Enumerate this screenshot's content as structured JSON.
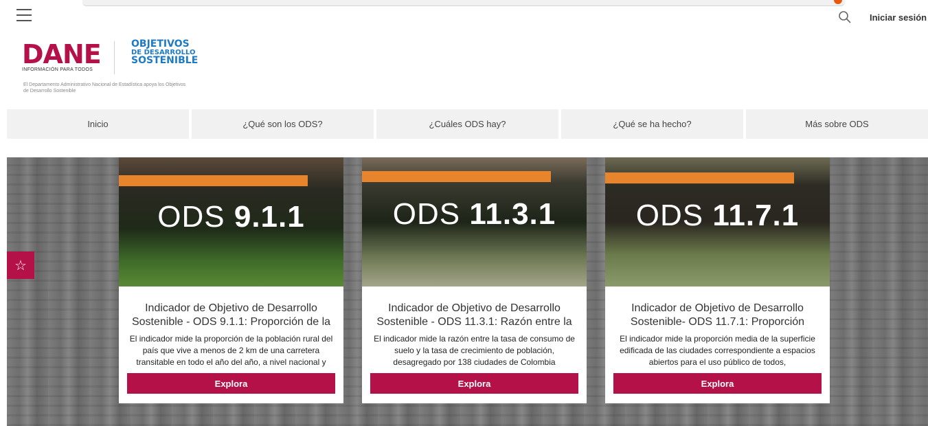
{
  "header": {
    "login_label": "Iniciar sesión"
  },
  "brand": {
    "dane_word": "DANE",
    "dane_tagline": "INFORMACIÓN PARA TODOS",
    "ods_line1": "OBJETIVOS",
    "ods_line2": "DE DESARROLLO",
    "ods_line3": "SOSTENIBLE",
    "caption": "El Departamento Administrativo Nacional de Estadística apoya los Objetivos de Desarrollo Sostenible",
    "accent_color": "#b41149",
    "ods_color": "#1f7ac4"
  },
  "nav": {
    "items": [
      {
        "label": "Inicio"
      },
      {
        "label": "¿Qué son los ODS?"
      },
      {
        "label": "¿Cuáles ODS hay?"
      },
      {
        "label": "¿Qué se ha hecho?"
      },
      {
        "label": "Más sobre ODS"
      }
    ]
  },
  "cards": [
    {
      "image_prefix": "ODS",
      "image_code": "9.1.1",
      "title": "Indicador de Objetivo de Desarrollo Sostenible - ODS 9.1.1: Proporción de la",
      "description": "El indicador mide la proporción de la población rural del país que vive a menos de 2 km de una carretera transitable en todo el año del año, a nivel nacional y",
      "button_label": "Explora"
    },
    {
      "image_prefix": "ODS",
      "image_code": "11.3.1",
      "title": "Indicador de Objetivo de Desarrollo Sostenible - ODS 11.3.1: Razón entre la",
      "description": "El indicador mide la razón entre la tasa de consumo de suelo y la tasa de crecimiento de población, desagregado por 138 ciudades de Colombia",
      "button_label": "Explora"
    },
    {
      "image_prefix": "ODS",
      "image_code": "11.7.1",
      "title": "Indicador de Objetivo de Desarrollo Sostenible- ODS 11.7.1: Proporción",
      "description": "El indicador mide la proporción media de la superficie edificada de las ciudades correspondiente a espacios abiertos para el uso público de todos,",
      "button_label": "Explora"
    }
  ],
  "favorite_icon": "star-icon"
}
